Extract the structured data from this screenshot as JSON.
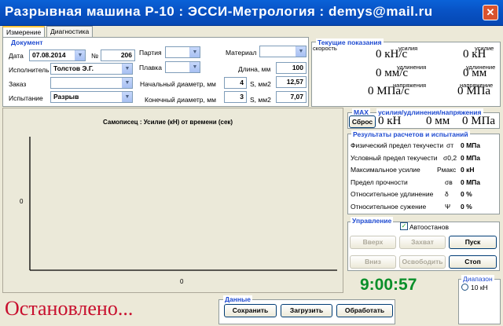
{
  "window": {
    "title": "Разрывная машина Р-10 : ЭССИ-Метрология : demys@mail.ru",
    "close_glyph": "✕"
  },
  "tabs": [
    {
      "label": "Измерение"
    },
    {
      "label": "Диагностика"
    }
  ],
  "document": {
    "group_label": "Документ",
    "date_label": "Дата",
    "date_value": "07.08.2014",
    "number_label": "№",
    "number_value": "206",
    "executor_label": "Исполнитель",
    "executor_value": "Толстов Э.Г.",
    "order_label": "Заказ",
    "order_value": "",
    "test_label": "Испытание",
    "test_value": "Разрыв",
    "batch_label": "Партия",
    "batch_value": "",
    "melt_label": "Плавка",
    "melt_value": "",
    "material_label": "Материал",
    "material_value": "",
    "length_label": "Длина, мм",
    "length_value": "100",
    "init_diam_label": "Начальный диаметр, мм",
    "init_diam_value": "4",
    "final_diam_label": "Конечный диаметр, мм",
    "final_diam_value": "3",
    "s_label": "S, мм2",
    "s1_value": "12,57",
    "s2_value": "7,07"
  },
  "current": {
    "group_label": "Текущие показания",
    "speed_label": "скорость",
    "force_label1": "усилия",
    "force_value1": "0 кН/с",
    "force_label2": "усилие",
    "force_value2": "0 кН",
    "elong_label1": "удлинения",
    "elong_value1": "0 мм/с",
    "elong_label2": "удлинение",
    "elong_value2": "0 мм",
    "stress_label1": "напряжения",
    "stress_value1": "0 МПа/с",
    "stress_label2": "напряжение",
    "stress_value2": "0 МПа"
  },
  "chart": {
    "title": "Самописец : Усилие (кН) от времени (сек)",
    "y_tick": "0",
    "x_tick": "0"
  },
  "max": {
    "label": "MAX",
    "header": "усилия/удлинения/напряжения",
    "reset_label": "Сброс",
    "force": "0 кН",
    "elong": "0 мм",
    "stress": "0 МПа"
  },
  "results": {
    "group_label": "Результаты расчетов и испытаний",
    "rows": [
      {
        "name": "Физический предел текучести",
        "sym": "σт",
        "value": "0 МПа"
      },
      {
        "name": "Условный предел текучести",
        "sym": "σ0,2",
        "value": "0 МПа"
      },
      {
        "name": "Максимальное усилие",
        "sym": "Pмакс",
        "value": "0 кН"
      },
      {
        "name": "Предел прочности",
        "sym": "σв",
        "value": "0 МПа"
      },
      {
        "name": "Относительное удлинение",
        "sym": "δ",
        "value": "0 %"
      },
      {
        "name": "Относительное сужение",
        "sym": "Ψ",
        "value": "0 %"
      }
    ]
  },
  "control": {
    "group_label": "Управление",
    "autostop_label": "Автоостанов",
    "up_label": "Вверх",
    "grip_label": "Захват",
    "start_label": "Пуск",
    "down_label": "Вниз",
    "release_label": "Освободить",
    "stop_label": "Стоп"
  },
  "timer": "9:00:57",
  "range": {
    "label": "Диапазон",
    "option": "10 кН"
  },
  "status": {
    "text": "Остановлено..."
  },
  "data_group": {
    "group_label": "Данные",
    "save_label": "Сохранить",
    "load_label": "Загрузить",
    "process_label": "Обработать"
  },
  "colors": {
    "titlebar": "#0852c4",
    "status": "#c8102e",
    "timer": "#0a8f2a",
    "group_label": "#1f4bd1"
  }
}
